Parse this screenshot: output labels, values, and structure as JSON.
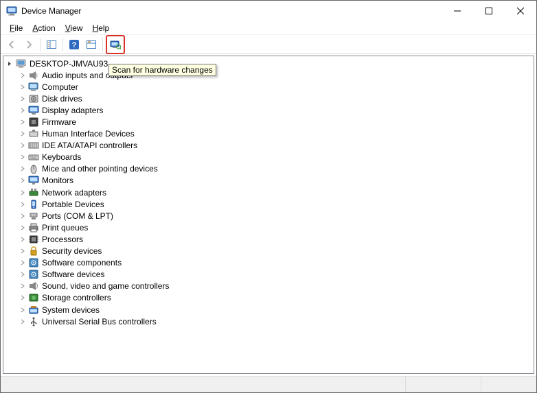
{
  "window": {
    "title": "Device Manager"
  },
  "menu": {
    "file": "File",
    "action": "Action",
    "view": "View",
    "help": "Help"
  },
  "tooltip": "Scan for hardware changes",
  "root": {
    "label": "DESKTOP-JMVAU93"
  },
  "categories": [
    {
      "label": "Audio inputs and outputs",
      "icon": "audio"
    },
    {
      "label": "Computer",
      "icon": "computer"
    },
    {
      "label": "Disk drives",
      "icon": "disk"
    },
    {
      "label": "Display adapters",
      "icon": "display"
    },
    {
      "label": "Firmware",
      "icon": "firmware"
    },
    {
      "label": "Human Interface Devices",
      "icon": "hid"
    },
    {
      "label": "IDE ATA/ATAPI controllers",
      "icon": "ide"
    },
    {
      "label": "Keyboards",
      "icon": "keyboard"
    },
    {
      "label": "Mice and other pointing devices",
      "icon": "mouse"
    },
    {
      "label": "Monitors",
      "icon": "monitor"
    },
    {
      "label": "Network adapters",
      "icon": "network"
    },
    {
      "label": "Portable Devices",
      "icon": "portable"
    },
    {
      "label": "Ports (COM & LPT)",
      "icon": "ports"
    },
    {
      "label": "Print queues",
      "icon": "printer"
    },
    {
      "label": "Processors",
      "icon": "processor"
    },
    {
      "label": "Security devices",
      "icon": "security"
    },
    {
      "label": "Software components",
      "icon": "software"
    },
    {
      "label": "Software devices",
      "icon": "software"
    },
    {
      "label": "Sound, video and game controllers",
      "icon": "sound"
    },
    {
      "label": "Storage controllers",
      "icon": "storage"
    },
    {
      "label": "System devices",
      "icon": "system"
    },
    {
      "label": "Universal Serial Bus controllers",
      "icon": "usb"
    }
  ]
}
